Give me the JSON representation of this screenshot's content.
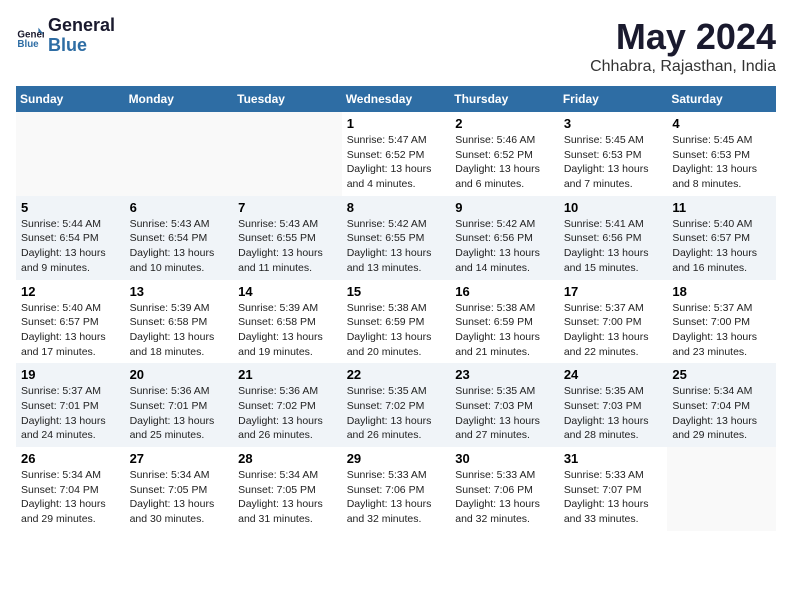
{
  "header": {
    "logo_line1": "General",
    "logo_line2": "Blue",
    "title": "May 2024",
    "subtitle": "Chhabra, Rajasthan, India"
  },
  "weekdays": [
    "Sunday",
    "Monday",
    "Tuesday",
    "Wednesday",
    "Thursday",
    "Friday",
    "Saturday"
  ],
  "weeks": [
    [
      {
        "num": "",
        "info": ""
      },
      {
        "num": "",
        "info": ""
      },
      {
        "num": "",
        "info": ""
      },
      {
        "num": "1",
        "info": "Sunrise: 5:47 AM\nSunset: 6:52 PM\nDaylight: 13 hours\nand 4 minutes."
      },
      {
        "num": "2",
        "info": "Sunrise: 5:46 AM\nSunset: 6:52 PM\nDaylight: 13 hours\nand 6 minutes."
      },
      {
        "num": "3",
        "info": "Sunrise: 5:45 AM\nSunset: 6:53 PM\nDaylight: 13 hours\nand 7 minutes."
      },
      {
        "num": "4",
        "info": "Sunrise: 5:45 AM\nSunset: 6:53 PM\nDaylight: 13 hours\nand 8 minutes."
      }
    ],
    [
      {
        "num": "5",
        "info": "Sunrise: 5:44 AM\nSunset: 6:54 PM\nDaylight: 13 hours\nand 9 minutes."
      },
      {
        "num": "6",
        "info": "Sunrise: 5:43 AM\nSunset: 6:54 PM\nDaylight: 13 hours\nand 10 minutes."
      },
      {
        "num": "7",
        "info": "Sunrise: 5:43 AM\nSunset: 6:55 PM\nDaylight: 13 hours\nand 11 minutes."
      },
      {
        "num": "8",
        "info": "Sunrise: 5:42 AM\nSunset: 6:55 PM\nDaylight: 13 hours\nand 13 minutes."
      },
      {
        "num": "9",
        "info": "Sunrise: 5:42 AM\nSunset: 6:56 PM\nDaylight: 13 hours\nand 14 minutes."
      },
      {
        "num": "10",
        "info": "Sunrise: 5:41 AM\nSunset: 6:56 PM\nDaylight: 13 hours\nand 15 minutes."
      },
      {
        "num": "11",
        "info": "Sunrise: 5:40 AM\nSunset: 6:57 PM\nDaylight: 13 hours\nand 16 minutes."
      }
    ],
    [
      {
        "num": "12",
        "info": "Sunrise: 5:40 AM\nSunset: 6:57 PM\nDaylight: 13 hours\nand 17 minutes."
      },
      {
        "num": "13",
        "info": "Sunrise: 5:39 AM\nSunset: 6:58 PM\nDaylight: 13 hours\nand 18 minutes."
      },
      {
        "num": "14",
        "info": "Sunrise: 5:39 AM\nSunset: 6:58 PM\nDaylight: 13 hours\nand 19 minutes."
      },
      {
        "num": "15",
        "info": "Sunrise: 5:38 AM\nSunset: 6:59 PM\nDaylight: 13 hours\nand 20 minutes."
      },
      {
        "num": "16",
        "info": "Sunrise: 5:38 AM\nSunset: 6:59 PM\nDaylight: 13 hours\nand 21 minutes."
      },
      {
        "num": "17",
        "info": "Sunrise: 5:37 AM\nSunset: 7:00 PM\nDaylight: 13 hours\nand 22 minutes."
      },
      {
        "num": "18",
        "info": "Sunrise: 5:37 AM\nSunset: 7:00 PM\nDaylight: 13 hours\nand 23 minutes."
      }
    ],
    [
      {
        "num": "19",
        "info": "Sunrise: 5:37 AM\nSunset: 7:01 PM\nDaylight: 13 hours\nand 24 minutes."
      },
      {
        "num": "20",
        "info": "Sunrise: 5:36 AM\nSunset: 7:01 PM\nDaylight: 13 hours\nand 25 minutes."
      },
      {
        "num": "21",
        "info": "Sunrise: 5:36 AM\nSunset: 7:02 PM\nDaylight: 13 hours\nand 26 minutes."
      },
      {
        "num": "22",
        "info": "Sunrise: 5:35 AM\nSunset: 7:02 PM\nDaylight: 13 hours\nand 26 minutes."
      },
      {
        "num": "23",
        "info": "Sunrise: 5:35 AM\nSunset: 7:03 PM\nDaylight: 13 hours\nand 27 minutes."
      },
      {
        "num": "24",
        "info": "Sunrise: 5:35 AM\nSunset: 7:03 PM\nDaylight: 13 hours\nand 28 minutes."
      },
      {
        "num": "25",
        "info": "Sunrise: 5:34 AM\nSunset: 7:04 PM\nDaylight: 13 hours\nand 29 minutes."
      }
    ],
    [
      {
        "num": "26",
        "info": "Sunrise: 5:34 AM\nSunset: 7:04 PM\nDaylight: 13 hours\nand 29 minutes."
      },
      {
        "num": "27",
        "info": "Sunrise: 5:34 AM\nSunset: 7:05 PM\nDaylight: 13 hours\nand 30 minutes."
      },
      {
        "num": "28",
        "info": "Sunrise: 5:34 AM\nSunset: 7:05 PM\nDaylight: 13 hours\nand 31 minutes."
      },
      {
        "num": "29",
        "info": "Sunrise: 5:33 AM\nSunset: 7:06 PM\nDaylight: 13 hours\nand 32 minutes."
      },
      {
        "num": "30",
        "info": "Sunrise: 5:33 AM\nSunset: 7:06 PM\nDaylight: 13 hours\nand 32 minutes."
      },
      {
        "num": "31",
        "info": "Sunrise: 5:33 AM\nSunset: 7:07 PM\nDaylight: 13 hours\nand 33 minutes."
      },
      {
        "num": "",
        "info": ""
      }
    ]
  ]
}
